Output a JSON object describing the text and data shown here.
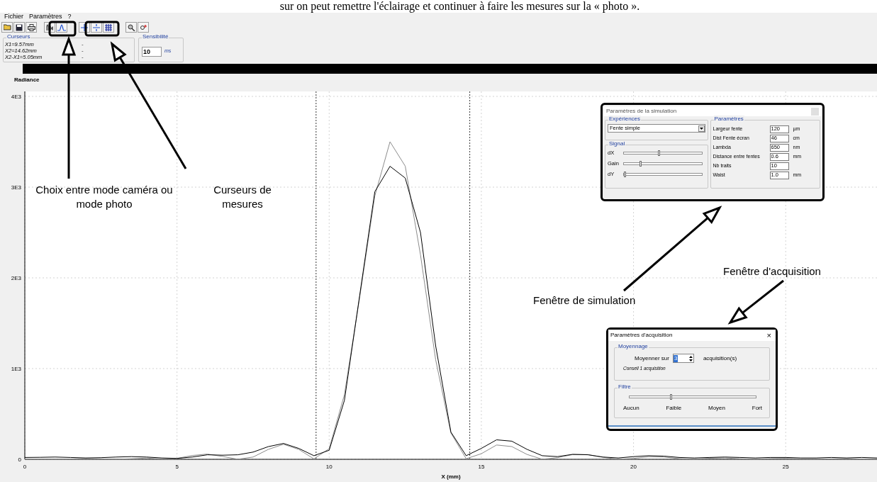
{
  "document_text": "sur on peut remettre l'éclairage et continuer à faire les mesures sur la « photo ».",
  "menu": [
    "Fichier",
    "Paramètres",
    "?"
  ],
  "cursors_panel": {
    "title": "Curseurs",
    "lines": [
      {
        "label": "X1=9.57mm",
        "value": "-"
      },
      {
        "label": "X2=14.62mm",
        "value": "-"
      },
      {
        "label": "X2-X1=5.05mm",
        "value": "-"
      }
    ]
  },
  "sensitivity_panel": {
    "title": "Sensibilité",
    "value": "10",
    "unit": "ms"
  },
  "chart": {
    "ylabel_title": "Radiance",
    "chart_data": {
      "type": "line",
      "grid": true,
      "ref_lines": [
        {
          "axis": "x",
          "value": 9.57,
          "color": "#000000"
        },
        {
          "axis": "x",
          "value": 14.62,
          "color": "#000000"
        }
      ],
      "xlabel": "X (mm)",
      "xlim": [
        0,
        28
      ],
      "ylim": [
        0,
        4000
      ],
      "xticks": [
        0,
        5,
        10,
        15,
        20,
        25
      ],
      "yticks": [
        {
          "value": 0,
          "label": "0"
        },
        {
          "value": 1000,
          "label": "1E3"
        },
        {
          "value": 2000,
          "label": "2E3"
        },
        {
          "value": 3000,
          "label": "3E3"
        },
        {
          "value": 4000,
          "label": "4E3"
        }
      ],
      "x": [
        0,
        0.5,
        1,
        1.5,
        2,
        2.5,
        3,
        3.5,
        4,
        4.5,
        5,
        5.5,
        6,
        6.5,
        7,
        7.5,
        8,
        8.5,
        9,
        9.5,
        10,
        10.5,
        11,
        11.5,
        12,
        12.5,
        13,
        13.5,
        14,
        14.5,
        15,
        15.5,
        16,
        16.5,
        17,
        17.5,
        18,
        18.5,
        19,
        19.5,
        20,
        20.5,
        21,
        21.5,
        22,
        22.5,
        23,
        23.5,
        24,
        24.5,
        25,
        25.5,
        26,
        26.5,
        27,
        27.5,
        28
      ],
      "series": [
        {
          "color": "#8c8c8c",
          "values": [
            5,
            3,
            1,
            4,
            8,
            5,
            1,
            6,
            14,
            3,
            10,
            42,
            58,
            31,
            1,
            25,
            109,
            166,
            109,
            5,
            117,
            713,
            1779,
            2904,
            3500,
            3231,
            2253,
            1097,
            290,
            6,
            62,
            158,
            141,
            54,
            1,
            18,
            52,
            52,
            22,
            1,
            10,
            28,
            25,
            8,
            1,
            12,
            16,
            6,
            1,
            8,
            10,
            4,
            1,
            5,
            7,
            3,
            1
          ]
        },
        {
          "color": "#000000",
          "values": [
            20,
            22,
            25,
            20,
            15,
            18,
            25,
            30,
            25,
            15,
            10,
            25,
            50,
            45,
            50,
            80,
            140,
            175,
            120,
            40,
            100,
            650,
            1800,
            2950,
            3230,
            3100,
            2500,
            1250,
            300,
            40,
            120,
            215,
            200,
            110,
            40,
            30,
            55,
            50,
            25,
            15,
            30,
            40,
            35,
            20,
            15,
            20,
            25,
            20,
            15,
            20,
            20,
            15,
            15,
            20,
            15,
            20,
            15
          ]
        }
      ]
    }
  },
  "simulation_dialog": {
    "title": "Paramètres de la simulation",
    "experiences": {
      "title": "Expériences",
      "value": "Fente simple"
    },
    "signal": {
      "title": "Signal",
      "sliders": [
        {
          "label": "dX",
          "level": 0.45
        },
        {
          "label": "Gain",
          "level": 0.22
        },
        {
          "label": "dY",
          "level": 0.02
        }
      ]
    },
    "parameters": {
      "title": "Paramètres",
      "fields": [
        {
          "label": "Largeur fente",
          "value": "120",
          "unit": "µm"
        },
        {
          "label": "Dist Fente écran",
          "value": "46",
          "unit": "cm"
        },
        {
          "label": "Lambda",
          "value": "650",
          "unit": "nm"
        },
        {
          "label": "Distance entre fentes",
          "value": "0.6",
          "unit": "mm"
        },
        {
          "label": "Nb traits",
          "value": "10"
        },
        {
          "label": "Waist",
          "value": "1.0",
          "unit": "mm"
        }
      ]
    }
  },
  "acquisition_dialog": {
    "title": "Paramètres d'acquisition",
    "close": "×",
    "averaging": {
      "title": "Moyennage",
      "label": "Moyenner sur",
      "value": "3",
      "unit": "acquisition(s)",
      "hint": "Conseil 1 acquisition"
    },
    "filter": {
      "title": "Filtre",
      "level": 0.33,
      "ticks": [
        "Aucun",
        "Faible",
        "Moyen",
        "Fort"
      ]
    }
  },
  "annotations": [
    {
      "kind": "mode",
      "text": "Choix entre mode caméra ou mode photo"
    },
    {
      "kind": "cursors",
      "text": "Curseurs de mesures"
    },
    {
      "kind": "simulation",
      "text": "Fenêtre de simulation"
    },
    {
      "kind": "acquisition",
      "text": "Fenêtre d'acquisition"
    }
  ]
}
